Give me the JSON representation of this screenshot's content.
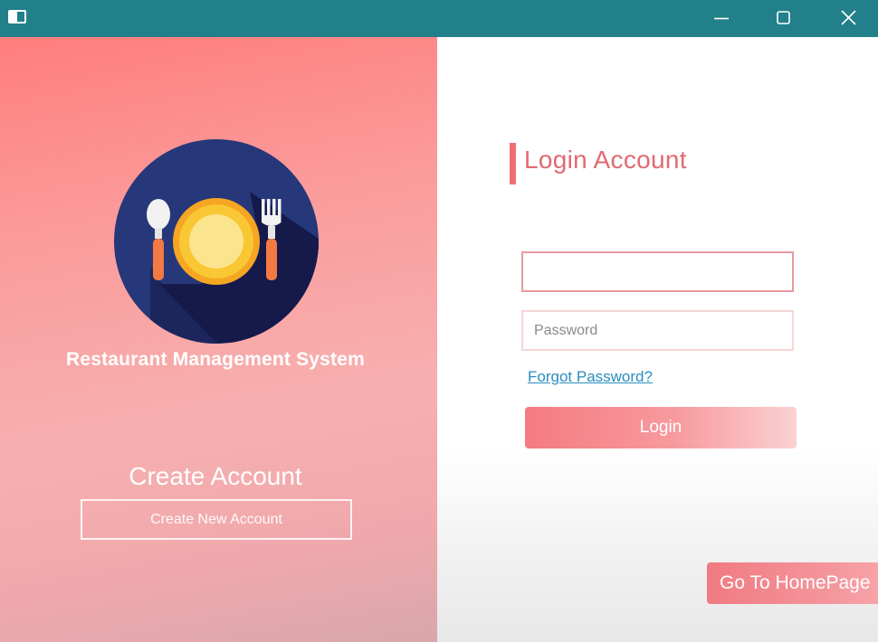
{
  "window": {
    "icons": {
      "app": "window-app-icon",
      "minimize": "minimize-icon",
      "maximize": "maximize-icon",
      "close": "close-icon"
    },
    "colors": {
      "titlebar": "#22808a",
      "accent": "#ef6f74"
    }
  },
  "branding": {
    "logo_icon": "plate-spoon-fork-icon",
    "system_name": "Restaurant Management System"
  },
  "signup": {
    "heading": "Create Account",
    "button_label": "Create New Account"
  },
  "login": {
    "title": "Login Account",
    "username_value": "",
    "password_placeholder": "Password",
    "forgot_link": "Forgot Password?",
    "button_label": "Login"
  },
  "navigation": {
    "home_button": "Go To HomePage"
  }
}
